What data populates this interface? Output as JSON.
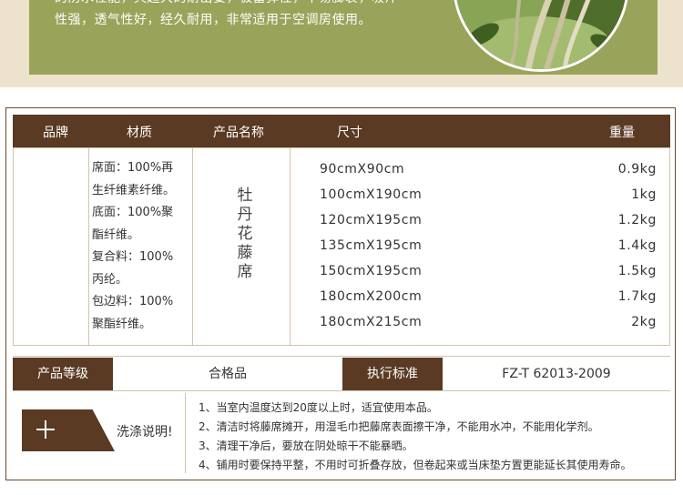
{
  "banner": {
    "text_lines": [
      "的防水性能，具超大的耐出要，极富弹性，不易膨裂，吸汗",
      "性强，透气性好，经久耐用，非常适用于空调房使用。"
    ],
    "photo": "rattan-plant-photo"
  },
  "table": {
    "headers": {
      "brand": "品牌",
      "material": "材质",
      "product_name": "产品名称",
      "size": "尺寸",
      "weight": "重量"
    },
    "brand_value": "",
    "material_lines": [
      "席面：100%再",
      "生纤维素纤维。",
      "底面：100%聚",
      "酯纤维。",
      "复合料：100%",
      "丙纶。",
      "包边料：100%",
      "聚酯纤维。"
    ],
    "product_name": "牡丹花藤席",
    "sizes": [
      "90cmX90cm",
      "100cmX190cm",
      "120cmX195cm",
      "135cmX195cm",
      "150cmX195cm",
      "180cmX200cm",
      "180cmX215cm"
    ],
    "weights": [
      "0.9kg",
      "1kg",
      "1.2kg",
      "1.4kg",
      "1.5kg",
      "1.7kg",
      "2kg"
    ]
  },
  "grade": {
    "label": "产品等级",
    "value": "合格品",
    "standard_label": "执行标准",
    "standard_value": "FZ-T 62013-2009"
  },
  "washing": {
    "title": "洗涤说明!",
    "icon": "plus-icon",
    "items": [
      "1、当室内温度达到20度以上时，适宜使用本品。",
      "2、清洁时将藤席摊开，用湿毛巾把藤席表面擦干净，不能用水冲，不能用化学剂。",
      "3、清理干净后，要放在阴处晾干不能暴晒。",
      "4、铺用时要保持平整，不用时可折叠存放，但卷起来或当床垫方置更能延长其使用寿命。"
    ]
  },
  "colors": {
    "header_brown": "#5a3a22",
    "banner_green": "#9aa35a",
    "banner_cream": "#ede3cc"
  }
}
